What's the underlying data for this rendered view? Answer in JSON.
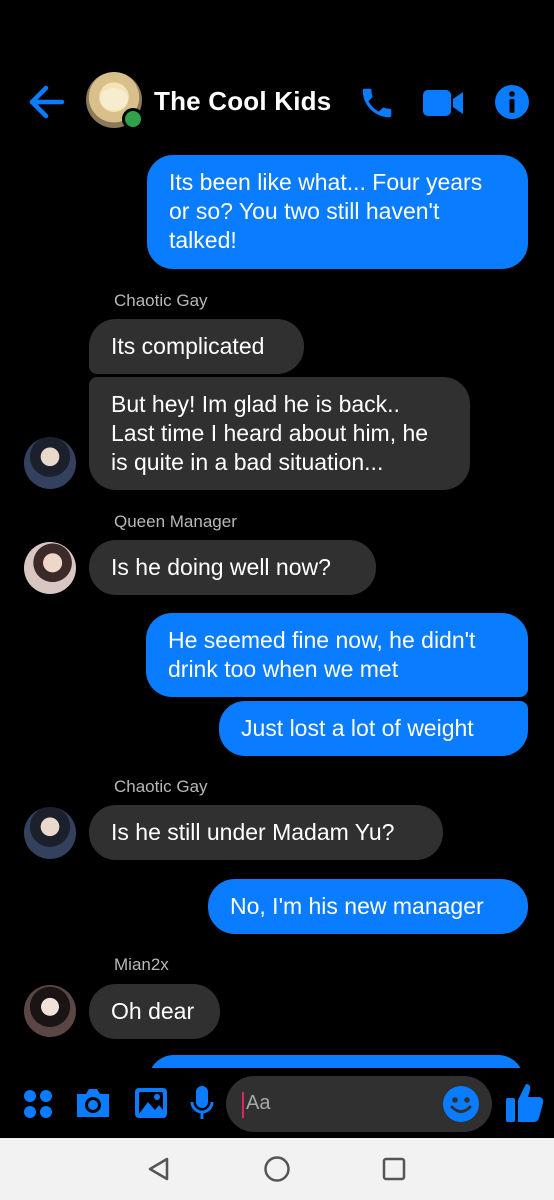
{
  "header": {
    "title": "The Cool Kids",
    "accent_color": "#0a7cff",
    "icons": [
      "back-arrow-icon",
      "phone-icon",
      "video-camera-icon",
      "info-icon"
    ]
  },
  "messages": [
    {
      "from": "me",
      "text": "Its been like what... Four years or so? You two still haven't talked!"
    },
    {
      "sender": "Chaotic Gay",
      "from": "them",
      "text": "Its complicated"
    },
    {
      "from": "them",
      "text": "But hey! Im glad he is back.. Last time I heard about him, he is quite in a bad situation..."
    },
    {
      "sender": "Queen Manager",
      "from": "them",
      "text": "Is he doing well now?"
    },
    {
      "from": "me",
      "text": "He seemed fine now, he didn't drink too when we met"
    },
    {
      "from": "me",
      "text": "Just lost a lot of weight"
    },
    {
      "sender": "Chaotic Gay",
      "from": "them",
      "text": "Is he still under Madam Yu?"
    },
    {
      "from": "me",
      "text": "No, I'm his new manager"
    },
    {
      "sender": "Mian2x",
      "from": "them",
      "text": "Oh dear"
    }
  ],
  "composer": {
    "placeholder": "Aa",
    "icons": [
      "apps-icon",
      "camera-icon",
      "gallery-icon",
      "microphone-icon",
      "emoji-icon",
      "thumbs-up-icon"
    ]
  },
  "navigation": {
    "icons": [
      "back-triangle-icon",
      "home-circle-icon",
      "recents-square-icon"
    ]
  }
}
